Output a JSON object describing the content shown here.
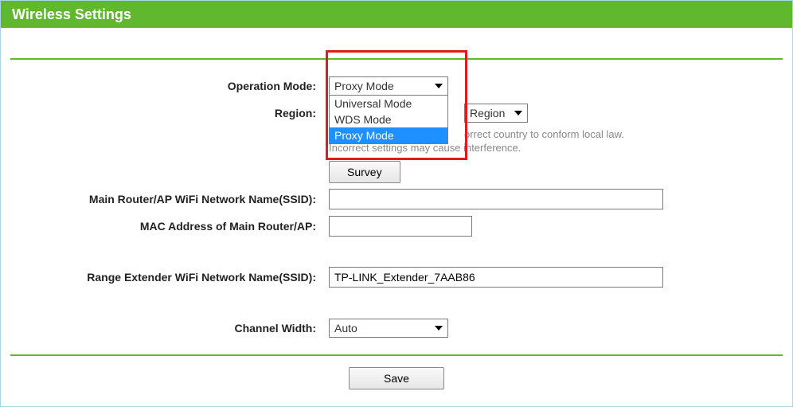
{
  "header": {
    "title": "Wireless Settings"
  },
  "form": {
    "operation_mode": {
      "label": "Operation Mode:",
      "selected": "Proxy Mode",
      "options": [
        "Universal Mode",
        "WDS Mode",
        "Proxy Mode"
      ],
      "highlighted_index": 2
    },
    "region": {
      "label": "Region:",
      "select_text": "Region",
      "hint_line1": "orrect country to conform local law.",
      "hint_line2": "Incorrect settings may cause interference."
    },
    "survey": {
      "button_label": "Survey"
    },
    "main_ssid": {
      "label": "Main Router/AP WiFi Network Name(SSID):",
      "value": ""
    },
    "main_mac": {
      "label": "MAC Address of Main Router/AP:",
      "value": ""
    },
    "extender_ssid": {
      "label": "Range Extender WiFi Network Name(SSID):",
      "value": "TP-LINK_Extender_7AAB86"
    },
    "channel_width": {
      "label": "Channel Width:",
      "selected": "Auto"
    },
    "save": {
      "button_label": "Save"
    }
  }
}
